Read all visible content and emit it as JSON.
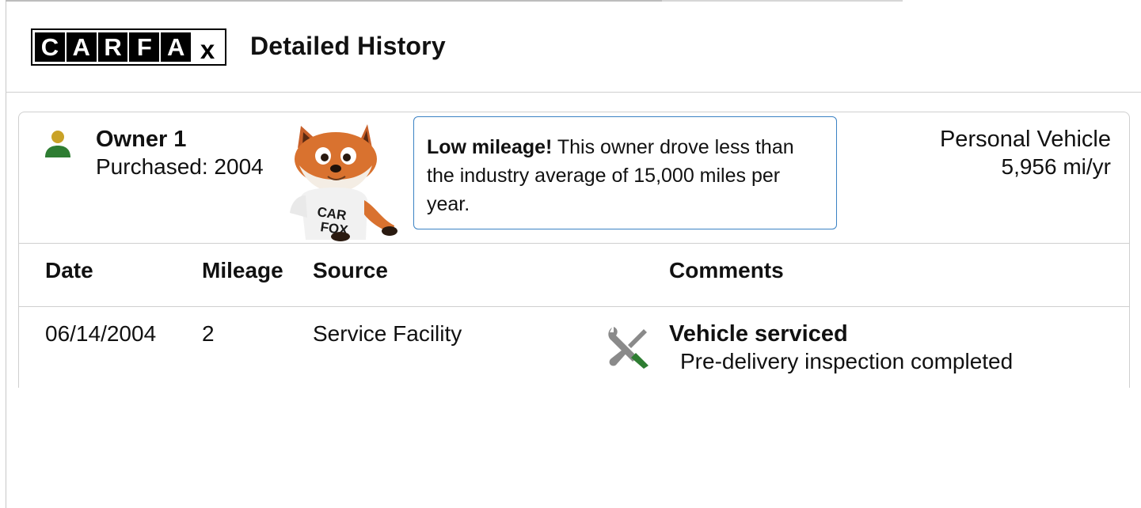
{
  "header": {
    "logo_letters": [
      "C",
      "A",
      "R",
      "F",
      "A",
      "x"
    ],
    "title": "Detailed History"
  },
  "owner": {
    "title": "Owner 1",
    "purchased": "Purchased: 2004",
    "icon": "person-icon",
    "icon_colors": {
      "head": "#c9a227",
      "body": "#2e7d32"
    }
  },
  "mileage_note": {
    "bold": "Low mileage!",
    "text": " This owner drove less than the industry average of 15,000 miles per year."
  },
  "usage": {
    "type": "Personal Vehicle",
    "miles_per_year": "5,956 mi/yr"
  },
  "table": {
    "headers": [
      "Date",
      "Mileage",
      "Source",
      "Comments"
    ],
    "rows": [
      {
        "date": "06/14/2004",
        "mileage": "2",
        "source": "Service Facility",
        "icon": "service-tools-icon",
        "comment_title": "Vehicle serviced",
        "comment_detail": "Pre-delivery inspection completed"
      }
    ]
  },
  "colors": {
    "note_border": "#3b82c4",
    "divider": "#cfcfcf",
    "tool_green": "#2e7d32",
    "tool_gray": "#8a8a8a"
  }
}
